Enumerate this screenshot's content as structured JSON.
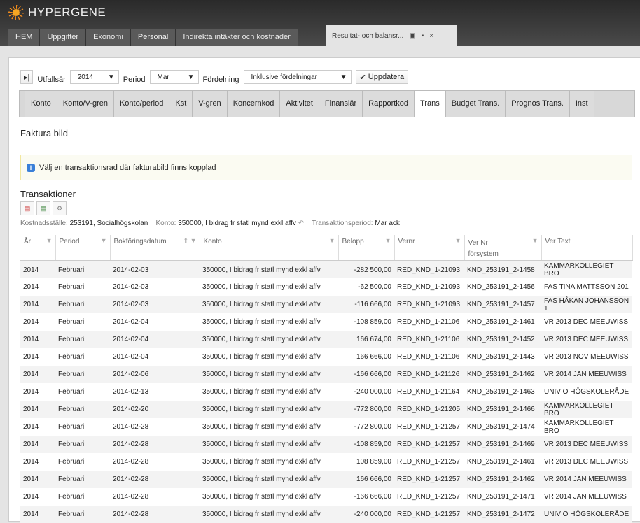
{
  "app": {
    "brand": "HYPERGENE"
  },
  "nav": [
    "HEM",
    "Uppgifter",
    "Ekonomi",
    "Personal",
    "Indirekta intäkter och kostnader"
  ],
  "window_tab": {
    "label": "Resultat- och balansr...",
    "icons": [
      "restore-icon",
      "save-icon",
      "close-icon"
    ],
    "close": "×"
  },
  "toolbar": {
    "utfallsar_label": "Utfallsår",
    "utfallsar": "2014",
    "period_label": "Period",
    "period": "Mar",
    "fordelning_label": "Fördelning",
    "fordelning": "Inklusive fördelningar",
    "update": "Uppdatera"
  },
  "tabs": [
    "Konto",
    "Konto/V-gren",
    "Konto/period",
    "Kst",
    "V-gren",
    "Koncernkod",
    "Aktivitet",
    "Finansiär",
    "Rapportkod",
    "Trans",
    "Budget Trans.",
    "Prognos Trans.",
    "Inst"
  ],
  "active_tab": "Trans",
  "faktura": {
    "title": "Faktura bild",
    "info": "Välj en transaktionsrad där fakturabild finns kopplad"
  },
  "trans": {
    "title": "Transaktioner",
    "filters": {
      "kst_label": "Kostnadsställe:",
      "kst": "253191, Socialhögskolan",
      "konto_label": "Konto:",
      "konto": "350000, I bidrag fr statl mynd exkl affv",
      "period_label": "Transaktionsperiod:",
      "period": "Mar ack"
    },
    "columns": [
      "År",
      "Period",
      "Bokföringsdatum",
      "Konto",
      "Belopp",
      "Vernr",
      "Ver Nr försystem",
      "Ver Text"
    ],
    "rows": [
      [
        "2014",
        "Februari",
        "2014-02-03",
        "350000, I bidrag fr statl mynd exkl affv",
        "-282 500,00",
        "RED_KND_1-21093",
        "KND_253191_2-1458",
        "KAMMARKOLLEGIET BRO"
      ],
      [
        "2014",
        "Februari",
        "2014-02-03",
        "350000, I bidrag fr statl mynd exkl affv",
        "-62 500,00",
        "RED_KND_1-21093",
        "KND_253191_2-1456",
        "FAS TINA MATTSSON 201"
      ],
      [
        "2014",
        "Februari",
        "2014-02-03",
        "350000, I bidrag fr statl mynd exkl affv",
        "-116 666,00",
        "RED_KND_1-21093",
        "KND_253191_2-1457",
        "FAS HÅKAN JOHANSSON 1"
      ],
      [
        "2014",
        "Februari",
        "2014-02-04",
        "350000, I bidrag fr statl mynd exkl affv",
        "-108 859,00",
        "RED_KND_1-21106",
        "KND_253191_2-1461",
        "VR 2013 DEC MEEUWISS"
      ],
      [
        "2014",
        "Februari",
        "2014-02-04",
        "350000, I bidrag fr statl mynd exkl affv",
        "166 674,00",
        "RED_KND_1-21106",
        "KND_253191_2-1452",
        "VR 2013 DEC MEEUWISS"
      ],
      [
        "2014",
        "Februari",
        "2014-02-04",
        "350000, I bidrag fr statl mynd exkl affv",
        "166 666,00",
        "RED_KND_1-21106",
        "KND_253191_2-1443",
        "VR 2013 NOV MEEUWISS"
      ],
      [
        "2014",
        "Februari",
        "2014-02-06",
        "350000, I bidrag fr statl mynd exkl affv",
        "-166 666,00",
        "RED_KND_1-21126",
        "KND_253191_2-1462",
        "VR 2014 JAN MEEUWISS"
      ],
      [
        "2014",
        "Februari",
        "2014-02-13",
        "350000, I bidrag fr statl mynd exkl affv",
        "-240 000,00",
        "RED_KND_1-21164",
        "KND_253191_2-1463",
        "UNIV O HÖGSKOLERÅDE"
      ],
      [
        "2014",
        "Februari",
        "2014-02-20",
        "350000, I bidrag fr statl mynd exkl affv",
        "-772 800,00",
        "RED_KND_1-21205",
        "KND_253191_2-1466",
        "KAMMARKOLLEGIET BRO"
      ],
      [
        "2014",
        "Februari",
        "2014-02-28",
        "350000, I bidrag fr statl mynd exkl affv",
        "-772 800,00",
        "RED_KND_1-21257",
        "KND_253191_2-1474",
        "KAMMARKOLLEGIET BRO"
      ],
      [
        "2014",
        "Februari",
        "2014-02-28",
        "350000, I bidrag fr statl mynd exkl affv",
        "-108 859,00",
        "RED_KND_1-21257",
        "KND_253191_2-1469",
        "VR 2013 DEC MEEUWISS"
      ],
      [
        "2014",
        "Februari",
        "2014-02-28",
        "350000, I bidrag fr statl mynd exkl affv",
        "108 859,00",
        "RED_KND_1-21257",
        "KND_253191_2-1461",
        "VR 2013 DEC MEEUWISS"
      ],
      [
        "2014",
        "Februari",
        "2014-02-28",
        "350000, I bidrag fr statl mynd exkl affv",
        "166 666,00",
        "RED_KND_1-21257",
        "KND_253191_2-1462",
        "VR 2014 JAN MEEUWISS"
      ],
      [
        "2014",
        "Februari",
        "2014-02-28",
        "350000, I bidrag fr statl mynd exkl affv",
        "-166 666,00",
        "RED_KND_1-21257",
        "KND_253191_2-1471",
        "VR 2014 JAN MEEUWISS"
      ],
      [
        "2014",
        "Februari",
        "2014-02-28",
        "350000, I bidrag fr statl mynd exkl affv",
        "-240 000,00",
        "RED_KND_1-21257",
        "KND_253191_2-1472",
        "UNIV O HÖGSKOLERÅDE"
      ]
    ]
  }
}
